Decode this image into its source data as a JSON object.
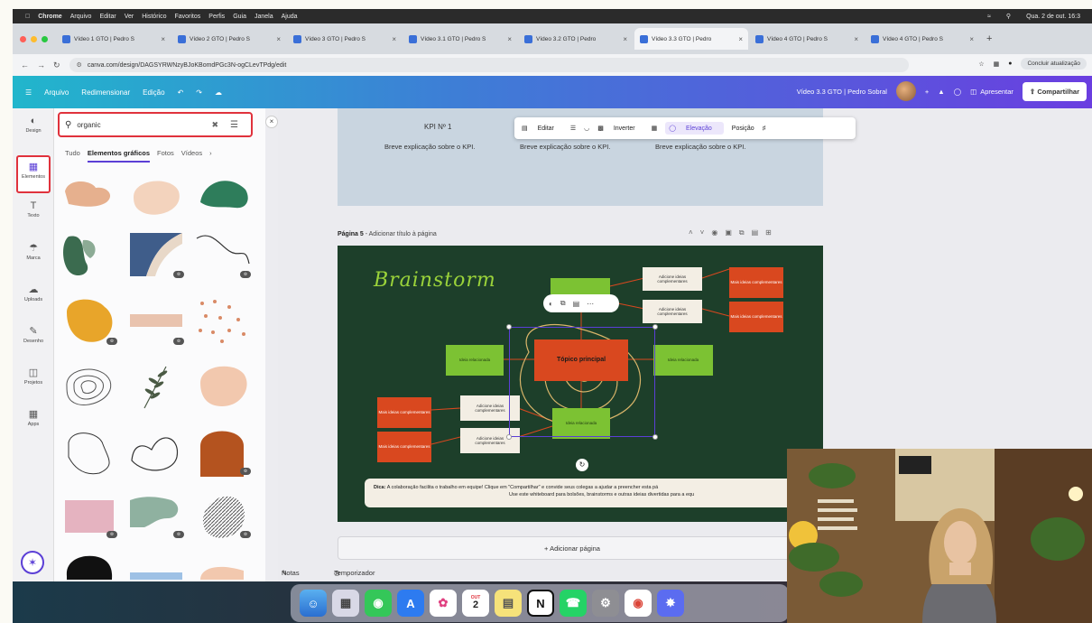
{
  "menubar": {
    "items": [
      "Chrome",
      "Arquivo",
      "Editar",
      "Ver",
      "Histórico",
      "Favoritos",
      "Perfis",
      "Guia",
      "Janela",
      "Ajuda"
    ],
    "clock": "Qua. 2 de out. 16:3"
  },
  "tabs": [
    {
      "label": "Vídeo 1 GTO | Pedro S"
    },
    {
      "label": "Vídeo 2 GTO | Pedro S"
    },
    {
      "label": "Vídeo 3 GTO | Pedro S"
    },
    {
      "label": "Vídeo 3.1 GTO | Pedro S"
    },
    {
      "label": "Vídeo 3.2 GTO | Pedro"
    },
    {
      "label": "Vídeo 3.3 GTO | Pedro",
      "active": true
    },
    {
      "label": "Vídeo 4 GTO | Pedro S"
    },
    {
      "label": "Vídeo 4 GTO | Pedro S"
    }
  ],
  "address": {
    "url": "canva.com/design/DAGSYRWNzyBJoKBomdPGc3N-ogCLevTPdg/edit",
    "update": "Concluir atualização"
  },
  "canva": {
    "menu": [
      "Arquivo",
      "Redimensionar",
      "Edição"
    ],
    "doc_title": "Vídeo 3.3 GTO | Pedro Sobral",
    "present": "Apresentar",
    "share": "Compartilhar"
  },
  "rail": [
    {
      "label": "Design",
      "icon": "design-icon"
    },
    {
      "label": "Elementos",
      "icon": "elements-icon",
      "selected": true
    },
    {
      "label": "Texto",
      "icon": "text-icon"
    },
    {
      "label": "Marca",
      "icon": "brand-icon"
    },
    {
      "label": "Uploads",
      "icon": "upload-icon"
    },
    {
      "label": "Desenho",
      "icon": "draw-icon"
    },
    {
      "label": "Projetos",
      "icon": "folder-icon"
    },
    {
      "label": "Apps",
      "icon": "apps-icon"
    }
  ],
  "panel": {
    "query": "organic",
    "filters": [
      "Tudo",
      "Elementos gráficos",
      "Fotos",
      "Vídeos"
    ]
  },
  "context_toolbar": [
    "Editar",
    "Inverter",
    "Elevação",
    "Posição"
  ],
  "kpi": {
    "title": "KPI Nº 1",
    "desc": "Breve explicação sobre o KPI."
  },
  "page": {
    "label": "Página 5",
    "sub": "- Adicionar título à página"
  },
  "board": {
    "title": "Brainstorm",
    "main": "Tópico principal",
    "related": "Ideia relacionada",
    "complement": "Adicione ideias complementares",
    "more": "Mais ideias complementares",
    "tip_bold": "Dica:",
    "tip_line1": "A colaboração facilita o trabalho em equipe! Clique em \"Compartilhar\" e convide seus colegas a ajudar a preencher esta pá",
    "tip_line2": "Use este whiteboard para bolsões, brainstorms e outras ideias divertidas para a equ"
  },
  "add_page": "+ Adicionar página",
  "footer": {
    "notes": "Notas",
    "timer": "Temporizador"
  },
  "dock_calendar": {
    "month": "OUT",
    "day": "2"
  },
  "colors": {
    "accent": "#5b3fd6",
    "highlight": "#e0323c",
    "board_bg": "#1d3f2a"
  }
}
